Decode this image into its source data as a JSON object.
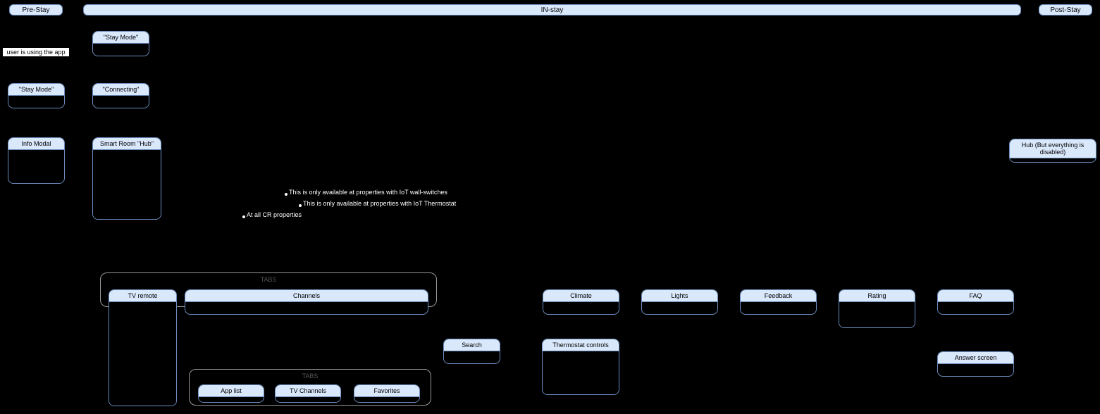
{
  "phases": {
    "pre": "Pre-Stay",
    "in": "IN-stay",
    "post": "Post-Stay"
  },
  "pre": {
    "user_note": "user is using the app",
    "stay_mode": "\"Stay Mode\"",
    "info_modal": "Info Modal"
  },
  "instay": {
    "stay_mode": "\"Stay Mode\"",
    "connecting": "\"Connecting\"",
    "hub": "Smart Room \"Hub\"",
    "notes": {
      "wall": "This is only available at properties with IoT wall-switches",
      "thermo": "This is only available at properties with IoT Thermostat",
      "all": "At all CR properties"
    }
  },
  "post": {
    "hub_disabled": "Hub (But everything is disabled)"
  },
  "tabs1": {
    "label": "TABS",
    "tv_remote": "TV remote",
    "channels": "Channels",
    "search": "Search"
  },
  "tabs2": {
    "label": "TABS",
    "app_list": "App list",
    "tv_channels": "TV Channels",
    "favorites": "Favorites"
  },
  "bottom": {
    "climate": "Climate",
    "thermostat": "Thermostat controls",
    "lights": "Lights",
    "feedback": "Feedback",
    "rating": "Rating",
    "faq": "FAQ",
    "answer": "Answer screen"
  }
}
